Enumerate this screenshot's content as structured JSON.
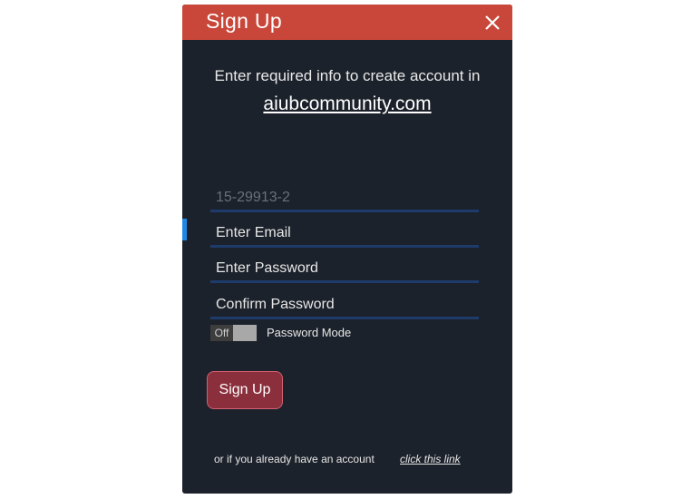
{
  "dialog": {
    "title": "Sign Up",
    "close_icon": "close-icon",
    "intro_text": "Enter required info to create account in",
    "site_link": "aiubcommunity.com"
  },
  "form": {
    "student_id_value": "15-29913-2",
    "email_placeholder": "Enter Email",
    "password_placeholder": "Enter Password",
    "confirm_placeholder": "Confirm Password",
    "toggle_state": "Off",
    "toggle_label": "Password Mode",
    "submit_label": "Sign Up"
  },
  "footer": {
    "text": "or if you already have an account",
    "link": "click this link"
  },
  "colors": {
    "background": "#1c222b",
    "titlebar": "#c9473a",
    "underline": "#1e3b6b",
    "button": "#8a2f3b",
    "focus_accent": "#1e88e5"
  }
}
